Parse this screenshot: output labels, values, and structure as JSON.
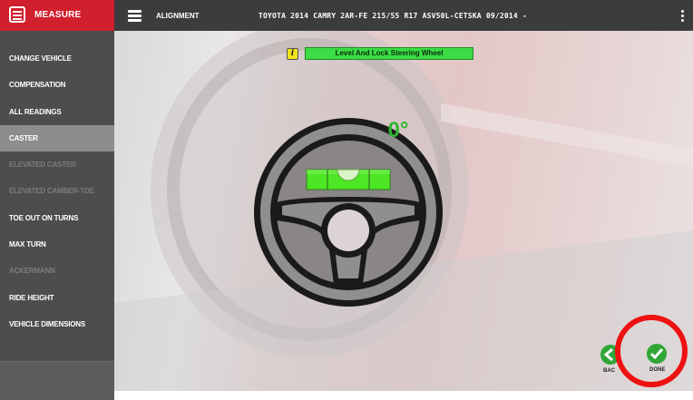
{
  "brand": {
    "title": "MEASURE",
    "icon": "measure-app-icon",
    "color": "#d0202d"
  },
  "header": {
    "section": "ALIGNMENT",
    "vehicle": "TOYOTA 2014 CAMRY 2AR-FE 215/55 R17 ASV50L-CETSKA 09/2014 -",
    "menu_icon": "hamburger-icon",
    "more_icon": "kebab-menu-icon"
  },
  "sidebar": {
    "items": [
      {
        "label": "CHANGE VEHICLE",
        "state": "enabled"
      },
      {
        "label": "COMPENSATION",
        "state": "enabled"
      },
      {
        "label": "ALL READINGS",
        "state": "enabled"
      },
      {
        "label": "CASTER",
        "state": "active"
      },
      {
        "label": "ELEVATED CASTER",
        "state": "disabled"
      },
      {
        "label": "ELEVATED CAMBER-TOE",
        "state": "disabled"
      },
      {
        "label": "TOE OUT ON TURNS",
        "state": "enabled"
      },
      {
        "label": "MAX TURN",
        "state": "enabled"
      },
      {
        "label": "ACKERMANN",
        "state": "disabled"
      },
      {
        "label": "RIDE HEIGHT",
        "state": "enabled"
      },
      {
        "label": "VEHICLE DIMENSIONS",
        "state": "enabled"
      }
    ]
  },
  "instruction": {
    "text": "Level And Lock Steering Wheel",
    "icon": "info-icon",
    "color": "#3bdc45"
  },
  "wheel": {
    "angle": "0°",
    "level_color": "#4de625"
  },
  "footer": {
    "back_label": "BACK",
    "done_label": "DONE",
    "back_icon": "arrow-left-icon",
    "done_icon": "checkmark-icon",
    "highlight_color": "#ee1111"
  }
}
